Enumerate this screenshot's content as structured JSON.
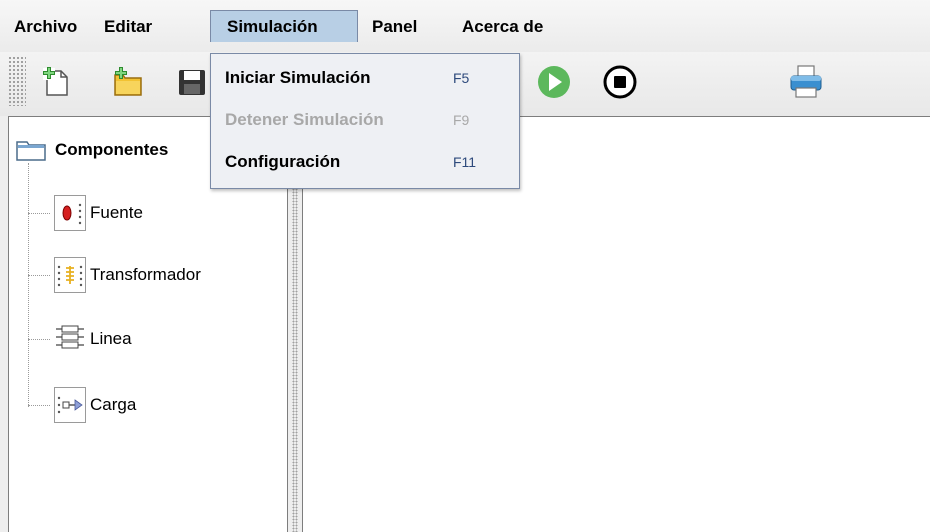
{
  "menubar": {
    "items": [
      {
        "label": "Archivo"
      },
      {
        "label": "Editar"
      },
      {
        "label": "Simulación"
      },
      {
        "label": "Panel"
      },
      {
        "label": "Acerca de"
      }
    ],
    "active_index": 2
  },
  "toolbar": {
    "icons": [
      "new-document-icon",
      "open-folder-icon",
      "save-icon",
      "play-icon",
      "stop-icon",
      "print-icon"
    ],
    "colors": {
      "play": "#5cb85c",
      "stop": "#000000",
      "folder": "#f2c232"
    }
  },
  "dropdown": {
    "items": [
      {
        "label": "Iniciar Simulación",
        "accelerator": "F5",
        "enabled": true
      },
      {
        "label": "Detener Simulación",
        "accelerator": "F9",
        "enabled": false
      },
      {
        "label": "Configuración",
        "accelerator": "F11",
        "enabled": true
      }
    ]
  },
  "tree": {
    "root_label": "Componentes",
    "nodes": [
      {
        "label": "Fuente",
        "icon": "source-icon"
      },
      {
        "label": "Transformador",
        "icon": "transformer-icon"
      },
      {
        "label": "Linea",
        "icon": "line-icon"
      },
      {
        "label": "Carga",
        "icon": "load-icon"
      }
    ]
  },
  "colors": {
    "menu_active_bg": "#b8cfe5",
    "dropdown_bg": "#eef0f4",
    "disabled_text": "#a8a8a8"
  }
}
